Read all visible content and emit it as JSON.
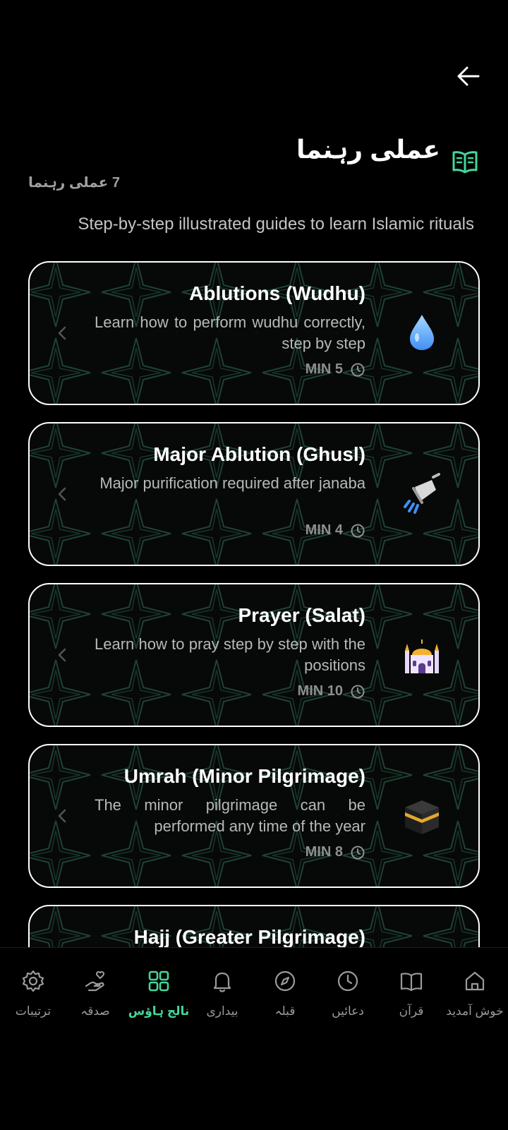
{
  "header": {
    "title": "عملی رہنما",
    "guide_count": "7 عملی رہنما",
    "subtitle": "Step-by-step illustrated guides to learn Islamic rituals",
    "back_icon": "arrow-left-icon",
    "title_icon": "open-book-icon"
  },
  "guides": [
    {
      "title": "Ablutions (Wudhu)",
      "description": "Learn how to perform wudhu correctly, step by step",
      "duration": "MIN 5",
      "icon": "water-drop-icon"
    },
    {
      "title": "Major Ablution (Ghusl)",
      "description": "Major purification required after janaba",
      "duration": "MIN 4",
      "icon": "shower-icon"
    },
    {
      "title": "Prayer (Salat)",
      "description": "Learn how to pray step by step with the positions",
      "duration": "MIN 10",
      "icon": "mosque-icon"
    },
    {
      "title": "Umrah (Minor Pilgrimage)",
      "description": "The minor pilgrimage can be performed any time of the year",
      "duration": "MIN 8",
      "icon": "kaaba-icon"
    },
    {
      "title": "Hajj (Greater Pilgrimage)",
      "description": "",
      "duration": "",
      "icon": ""
    }
  ],
  "nav": {
    "items": [
      {
        "label": "ترتیبات",
        "icon": "gear-icon"
      },
      {
        "label": "صدقہ",
        "icon": "charity-hand-icon"
      },
      {
        "label": "نالج ہاؤس",
        "icon": "grid-icon",
        "active": true
      },
      {
        "label": "بیداری",
        "icon": "bell-icon"
      },
      {
        "label": "قبلہ",
        "icon": "compass-icon"
      },
      {
        "label": "دعائیں",
        "icon": "clock-icon"
      },
      {
        "label": "قرآن",
        "icon": "book-icon"
      },
      {
        "label": "خوش آمدید",
        "icon": "home-icon"
      }
    ]
  },
  "colors": {
    "accent": "#45d69a",
    "card_border": "#ffffff",
    "background": "#000000",
    "pattern": "#1b3a2c"
  }
}
